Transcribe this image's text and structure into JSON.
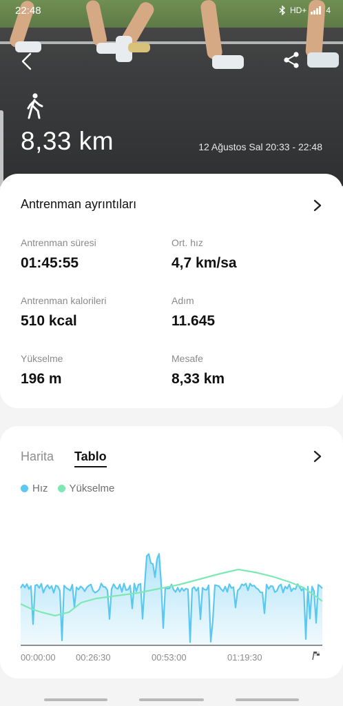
{
  "status_bar": {
    "time": "22:48",
    "network": "HD+",
    "battery": "4"
  },
  "header": {
    "activity_icon": "walking-person-icon",
    "distance": "8,33 km",
    "datetime": "12 Ağustos Sal 20:33 - 22:48"
  },
  "details": {
    "title": "Antrenman ayrıntıları",
    "metrics": [
      {
        "label": "Antrenman süresi",
        "value": "01:45:55"
      },
      {
        "label": "Ort. hız",
        "value": "4,7 km/sa"
      },
      {
        "label": "Antrenman kalorileri",
        "value": "510 kcal"
      },
      {
        "label": "Adım",
        "value": "11.645"
      },
      {
        "label": "Yükselme",
        "value": "196 m"
      },
      {
        "label": "Mesafe",
        "value": "8,33 km"
      }
    ]
  },
  "graph_card": {
    "tabs": [
      {
        "label": "Harita",
        "active": false
      },
      {
        "label": "Tablo",
        "active": true
      }
    ],
    "legend": [
      {
        "label": "Hız",
        "color": "#5ac8f0"
      },
      {
        "label": "Yükselme",
        "color": "#7ee8b4"
      }
    ],
    "x_ticks": [
      "00:00:00",
      "00:26:30",
      "00:53:00",
      "01:19:30"
    ]
  },
  "colors": {
    "speed": "#5ac8f0",
    "elevation": "#7ee8b4"
  }
}
